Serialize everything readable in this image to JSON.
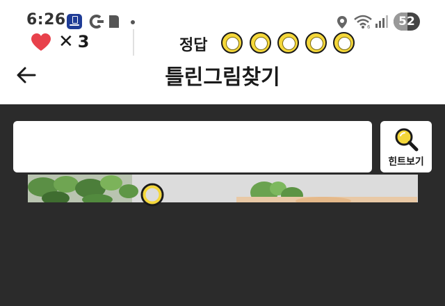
{
  "status_bar": {
    "time": "6:26",
    "battery_level": "52",
    "battery_fraction": 0.52
  },
  "header": {
    "title": "틀린그림찾기"
  },
  "game": {
    "lives_symbol": "✕",
    "lives_count": "3",
    "answer_label": "정답",
    "answer_slots": 5,
    "hint_label": "힌트보기"
  },
  "colors": {
    "slot_fill": "#f4d73a",
    "heart": "#e8414b",
    "game_bg": "#2b2b2b"
  }
}
